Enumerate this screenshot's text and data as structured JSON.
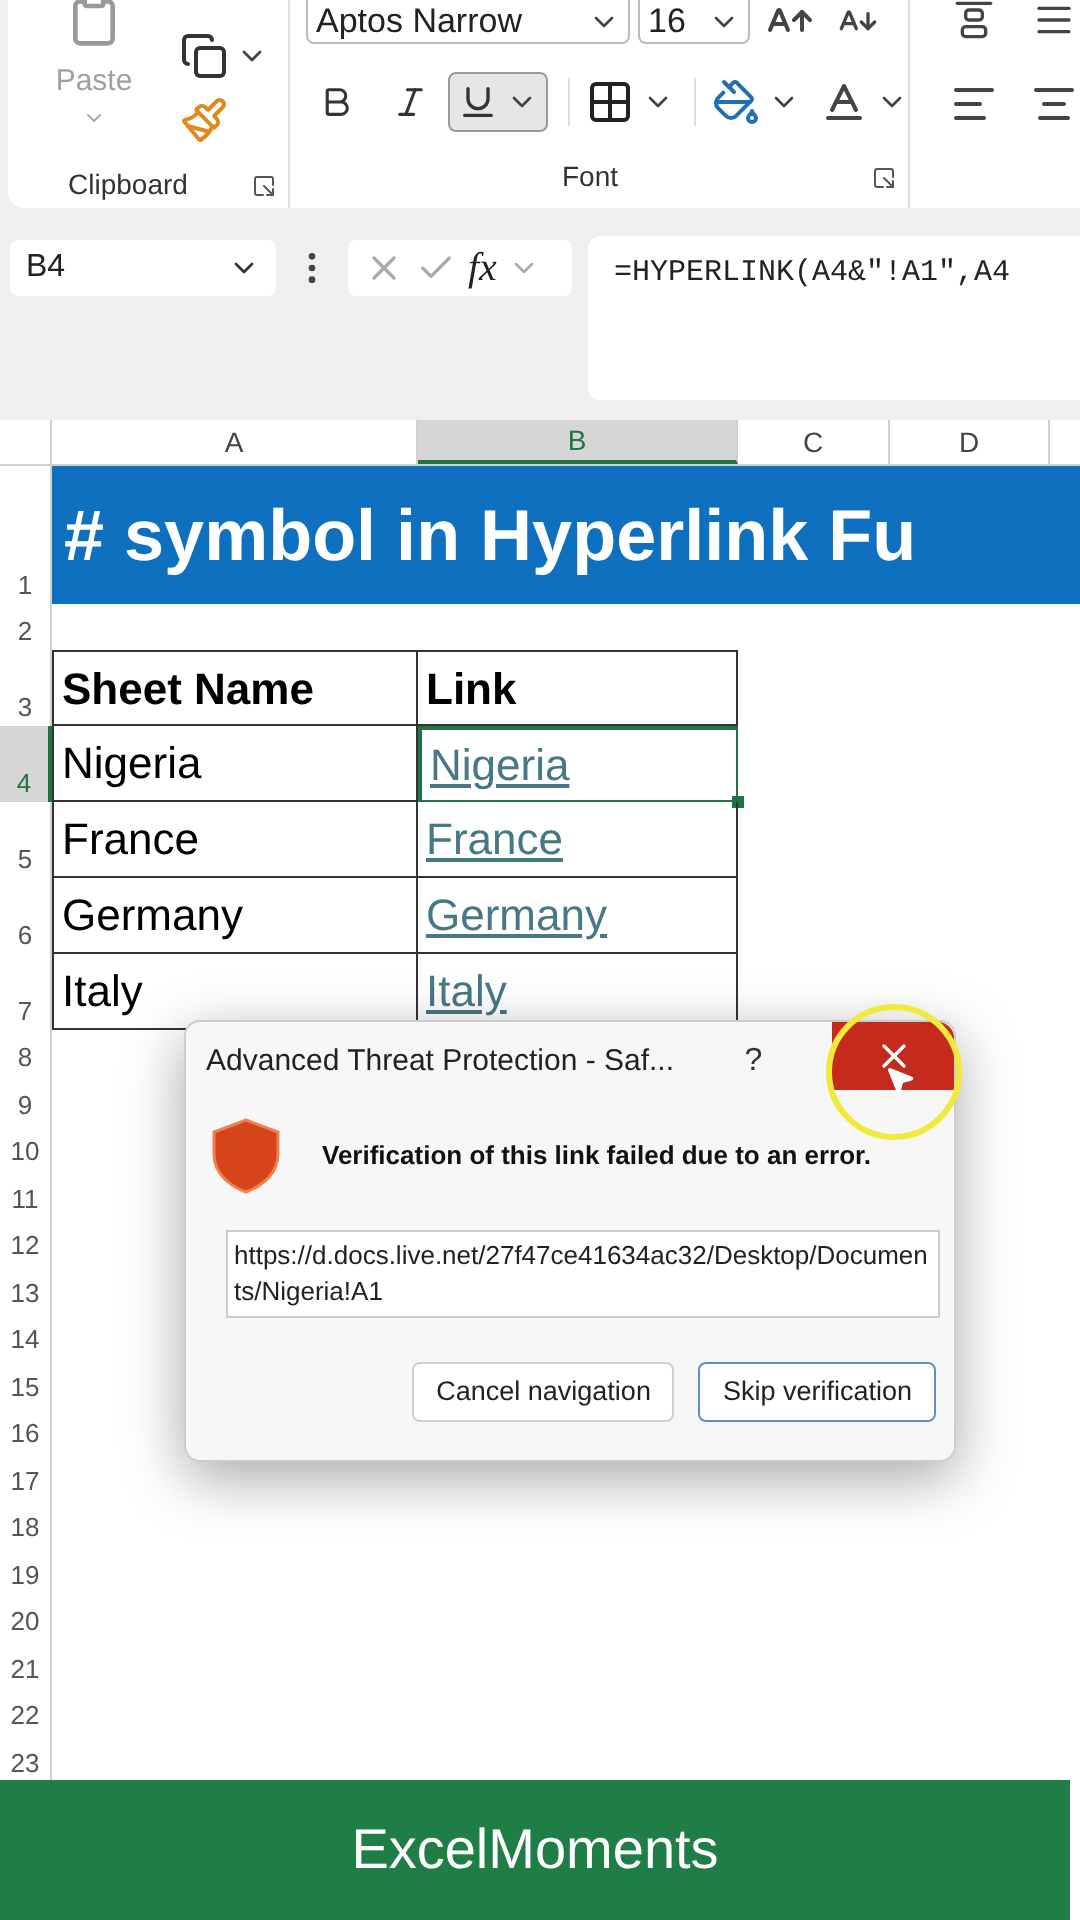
{
  "ribbon": {
    "clipboard": {
      "paste_label": "Paste",
      "paste_disabled": true,
      "group_label": "Clipboard"
    },
    "font": {
      "font_name": "Aptos Narrow",
      "font_size": "16",
      "underline_on": true,
      "group_label": "Font"
    }
  },
  "formula_bar": {
    "name_box": "B4",
    "fx_label": "fx",
    "formula": "=HYPERLINK(A4&\"!A1\",A4"
  },
  "columns": [
    {
      "label": "A",
      "selected": false
    },
    {
      "label": "B",
      "selected": true
    },
    {
      "label": "C",
      "selected": false
    },
    {
      "label": "D",
      "selected": false
    }
  ],
  "row_numbers": [
    {
      "label": "1",
      "selected": false
    },
    {
      "label": "2",
      "selected": false
    },
    {
      "label": "3",
      "selected": false
    },
    {
      "label": "4",
      "selected": true
    },
    {
      "label": "5",
      "selected": false
    },
    {
      "label": "6",
      "selected": false
    },
    {
      "label": "7",
      "selected": false
    },
    {
      "label": "8",
      "selected": false
    },
    {
      "label": "9",
      "selected": false
    },
    {
      "label": "10",
      "selected": false
    },
    {
      "label": "11",
      "selected": false
    },
    {
      "label": "12",
      "selected": false
    },
    {
      "label": "13",
      "selected": false
    },
    {
      "label": "14",
      "selected": false
    },
    {
      "label": "15",
      "selected": false
    },
    {
      "label": "16",
      "selected": false
    },
    {
      "label": "17",
      "selected": false
    },
    {
      "label": "18",
      "selected": false
    },
    {
      "label": "19",
      "selected": false
    },
    {
      "label": "20",
      "selected": false
    },
    {
      "label": "21",
      "selected": false
    },
    {
      "label": "22",
      "selected": false
    },
    {
      "label": "23",
      "selected": false
    }
  ],
  "title": "# symbol in Hyperlink Fu",
  "table": {
    "headers": [
      "Sheet Name",
      "Link"
    ],
    "rows": [
      {
        "name": "Nigeria",
        "link": "Nigeria",
        "selected": true
      },
      {
        "name": "France",
        "link": "France",
        "selected": false
      },
      {
        "name": "Germany",
        "link": "Germany",
        "selected": false
      },
      {
        "name": "Italy",
        "link": "Italy",
        "selected": false
      }
    ]
  },
  "dialog": {
    "title": "Advanced Threat Protection - Saf...",
    "help": "?",
    "message": "Verification of this link failed due to an error.",
    "url": "https://d.docs.live.net/27f47ce41634ac32/Desktop/Documents/Nigeria!A1",
    "buttons": [
      {
        "label": "Cancel navigation",
        "focused": false
      },
      {
        "label": "Skip verification",
        "focused": true
      }
    ]
  },
  "banner": "ExcelMoments"
}
